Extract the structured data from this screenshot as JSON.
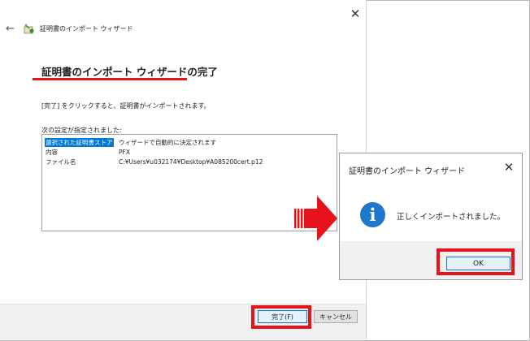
{
  "wizard": {
    "title": "証明書のインポート ウィザード",
    "heading": "証明書のインポート ウィザードの完了",
    "instruction": "[完了] をクリックすると、証明書がインポートされます。",
    "settings_label": "次の設定が指定されました:",
    "settings": [
      {
        "key": "選択された証明書ストア",
        "value": "ウィザードで自動的に決定されます"
      },
      {
        "key": "内容",
        "value": "PFX"
      },
      {
        "key": "ファイル名",
        "value": "C:¥Users¥u032174¥Desktop¥A085200cert.p12"
      }
    ],
    "finish_label": "完了(F)",
    "cancel_label": "キャンセル"
  },
  "message_box": {
    "title": "証明書のインポート ウィザード",
    "message": "正しくインポートされました。",
    "ok_label": "OK"
  },
  "colors": {
    "highlight": "#e8121b",
    "accent": "#0078d7",
    "info_icon": "#1f77c9"
  }
}
